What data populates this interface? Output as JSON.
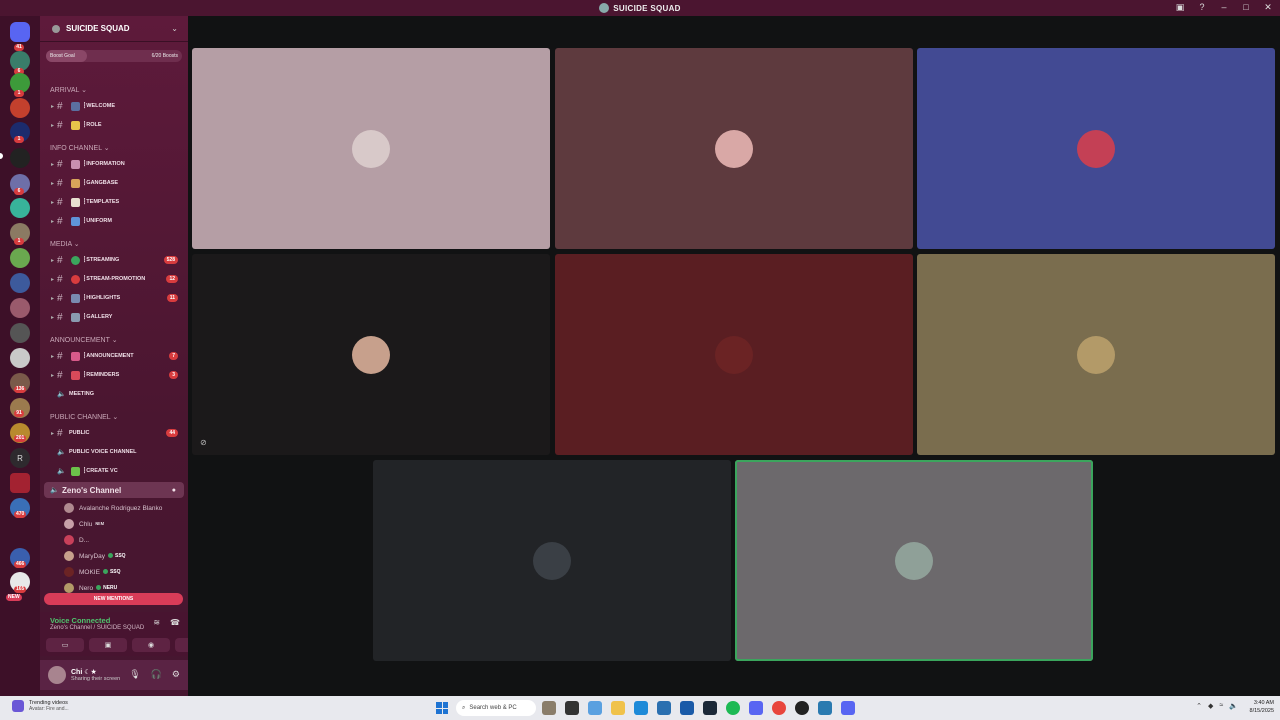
{
  "window": {
    "title": "SUICIDE SQUAD"
  },
  "server": {
    "name": "SUICIDE SQUAD",
    "boost_label": "Boost Goal",
    "boost_count": "6/20 Boosts",
    "boost_progress": 0.3
  },
  "rail_badges": [
    "41",
    "6",
    "1",
    "1",
    "6",
    "1",
    "136",
    "91",
    "201",
    "470",
    "466",
    "165"
  ],
  "rail_letter": "R",
  "rail_new": "NEW",
  "categories": {
    "arrival": "ARRIVAL",
    "info": "INFO CHANNEL",
    "media": "MEDIA",
    "announcement": "ANNOUNCEMENT",
    "public": "PUBLIC CHANNEL"
  },
  "channels": {
    "welcome": "┇WELCOME",
    "role": "┇ROLE",
    "information": "┇INFORMATION",
    "gangbase": "┇GANGBASE",
    "templates": "┇TEMPLATES",
    "uniform": "┇UNIFORM",
    "streaming": "┇STREAMING",
    "streaming_count": "528",
    "stream_promotion": "┇STREAM-PROMOTION",
    "stream_promotion_count": "12",
    "highlights": "┇HIGHLIGHTS",
    "highlights_count": "11",
    "gallery": "┇GALLERY",
    "announcement": "┇ANNOUNCEMENT",
    "announcement_count": "7",
    "reminders": "┇REMINDERS",
    "reminders_count": "3",
    "meeting": "MEETING",
    "public": "PUBLIC",
    "public_count": "44",
    "public_voice": "PUBLIC VOICE CHANNEL",
    "create_vc": "┇CREATE VC",
    "zenos": "Zeno's Channel"
  },
  "members": [
    {
      "name": "Avalanche Rodriguez Blanko",
      "tag": ""
    },
    {
      "name": "Chlu",
      "tag": "ɴᴇᴍ"
    },
    {
      "name": "D...",
      "tag": ""
    },
    {
      "name": "MaryDay",
      "tag": "SSQ"
    },
    {
      "name": "MOKIE",
      "tag": "SSQ"
    },
    {
      "name": "Nero",
      "tag": "NERU"
    }
  ],
  "new_mentions": "NEW MENTIONS",
  "voice": {
    "status": "Voice Connected",
    "channel": "Zeno's Channel / SUICIDE SQUAD"
  },
  "user": {
    "name": "Chi ☾★",
    "status": "Sharing their screen"
  },
  "tiles": [
    {
      "bg": "#b59ea5",
      "avatar": "#d8c9c9"
    },
    {
      "bg": "#5e3a3e",
      "avatar": "#d9a8a6"
    },
    {
      "bg": "#424a93",
      "avatar": "#c44055"
    },
    {
      "bg": "#1b191a",
      "avatar": "#c7a08c"
    },
    {
      "bg": "#5a1e22",
      "avatar": "#6b2324"
    },
    {
      "bg": "#7a6d4e",
      "avatar": "#b39a68"
    },
    {
      "bg": "#222427",
      "avatar": "#3a3f45"
    },
    {
      "bg": "#6c696c",
      "avatar": "#8fa098"
    }
  ],
  "taskbar": {
    "weather_title": "Trending videos",
    "weather_sub": "Avatar: Fire and...",
    "weather_badge": "3",
    "search_placeholder": "Search web & PC",
    "time": "3:40 AM",
    "date": "8/15/2025"
  }
}
